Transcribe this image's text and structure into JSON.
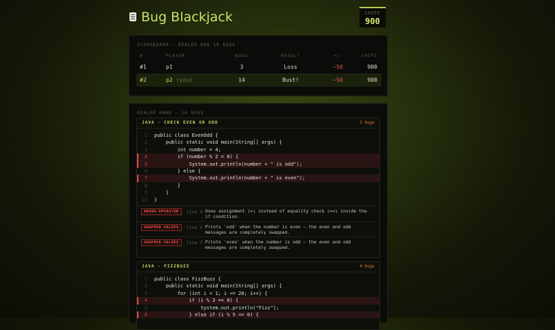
{
  "header": {
    "title": "Bug Blackjack",
    "chips_label": "CHIPS",
    "chips_value": "900"
  },
  "scoreboard": {
    "title": "SCOREBOARD — DEALER HAD 10 BUGS",
    "columns": [
      "#",
      "PLAYER",
      "BUGS",
      "RESULT",
      "+/-",
      "CHIPS"
    ],
    "rows": [
      {
        "rank": "#1",
        "player": "p1",
        "you": "",
        "bugs": "3",
        "result": "Loss",
        "delta": "−50",
        "chips": "900"
      },
      {
        "rank": "#2",
        "player": "p2",
        "you": "(you)",
        "bugs": "14",
        "result": "Bust!",
        "delta": "−50",
        "chips": "900"
      }
    ]
  },
  "hand": {
    "title": "DEALER HAND — 10 BUGS",
    "cards": [
      {
        "name": "JAVA · CHECK EVEN OR ODD",
        "count": "3 bugs",
        "lines": [
          {
            "n": "1",
            "code": "public class EvenOdd {",
            "bug": false
          },
          {
            "n": "2",
            "code": "    public static void main(String[] args) {",
            "bug": false
          },
          {
            "n": "3",
            "code": "        int number = 4;",
            "bug": false
          },
          {
            "n": "4",
            "code": "        if (number % 2 = 0) {",
            "bug": true
          },
          {
            "n": "5",
            "code": "            System.out.println(number + \" is odd\");",
            "bug": true
          },
          {
            "n": "6",
            "code": "        } else {",
            "bug": false
          },
          {
            "n": "7",
            "code": "            System.out.println(number + \" is even\");",
            "bug": true
          },
          {
            "n": "8",
            "code": "        }",
            "bug": false
          },
          {
            "n": "9",
            "code": "    }",
            "bug": false
          },
          {
            "n": "10",
            "code": "}",
            "bug": false
          }
        ],
        "notes": [
          {
            "tag": "WRONG OPERATOR",
            "line": "line 4",
            "text": "Uses assignment (=) instead of equality check (==) inside the if condition."
          },
          {
            "tag": "SWAPPED VALUES",
            "line": "line 5",
            "text": "Prints 'odd' when the number is even — the even and odd messages are completely swapped."
          },
          {
            "tag": "SWAPPED VALUES",
            "line": "line 7",
            "text": "Prints 'even' when the number is odd — the even and odd messages are completely swapped."
          }
        ]
      },
      {
        "name": "JAVA · FIZZBUZZ",
        "count": "4 bugs",
        "lines": [
          {
            "n": "1",
            "code": "public class FizzBuzz {",
            "bug": false
          },
          {
            "n": "2",
            "code": "    public static void main(String[] args) {",
            "bug": false
          },
          {
            "n": "3",
            "code": "        for (int i = 1; i <= 20; i++) {",
            "bug": false
          },
          {
            "n": "4",
            "code": "            if (i % 3 == 0) {",
            "bug": true
          },
          {
            "n": "5",
            "code": "                System.out.println(\"Fizz\");",
            "bug": false
          },
          {
            "n": "6",
            "code": "            } else if (i % 5 == 0) {",
            "bug": true
          }
        ],
        "notes": []
      }
    ]
  }
}
